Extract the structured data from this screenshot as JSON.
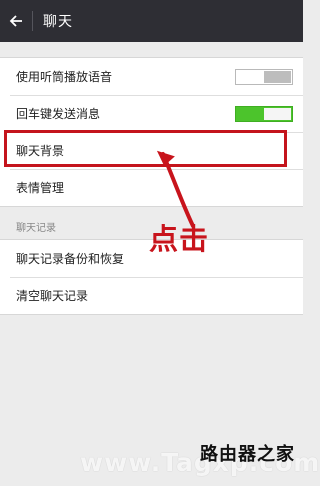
{
  "header": {
    "title": "聊天"
  },
  "settings": {
    "items": [
      {
        "label": "使用听筒播放语音",
        "toggle": "off"
      },
      {
        "label": "回车键发送消息",
        "toggle": "on"
      },
      {
        "label": "聊天背景"
      },
      {
        "label": "表情管理"
      }
    ]
  },
  "chat_records": {
    "header": "聊天记录",
    "items": [
      {
        "label": "聊天记录备份和恢复"
      },
      {
        "label": "清空聊天记录"
      }
    ]
  },
  "annotation": {
    "text": "点击",
    "color": "#c8141c"
  },
  "watermark": {
    "text": "www.Tagxp.com",
    "brand": "路由器之家"
  },
  "colors": {
    "titlebar": "#2e2e34",
    "toggle_on": "#4cc42c",
    "highlight": "#c4141c",
    "background": "#ececec"
  }
}
